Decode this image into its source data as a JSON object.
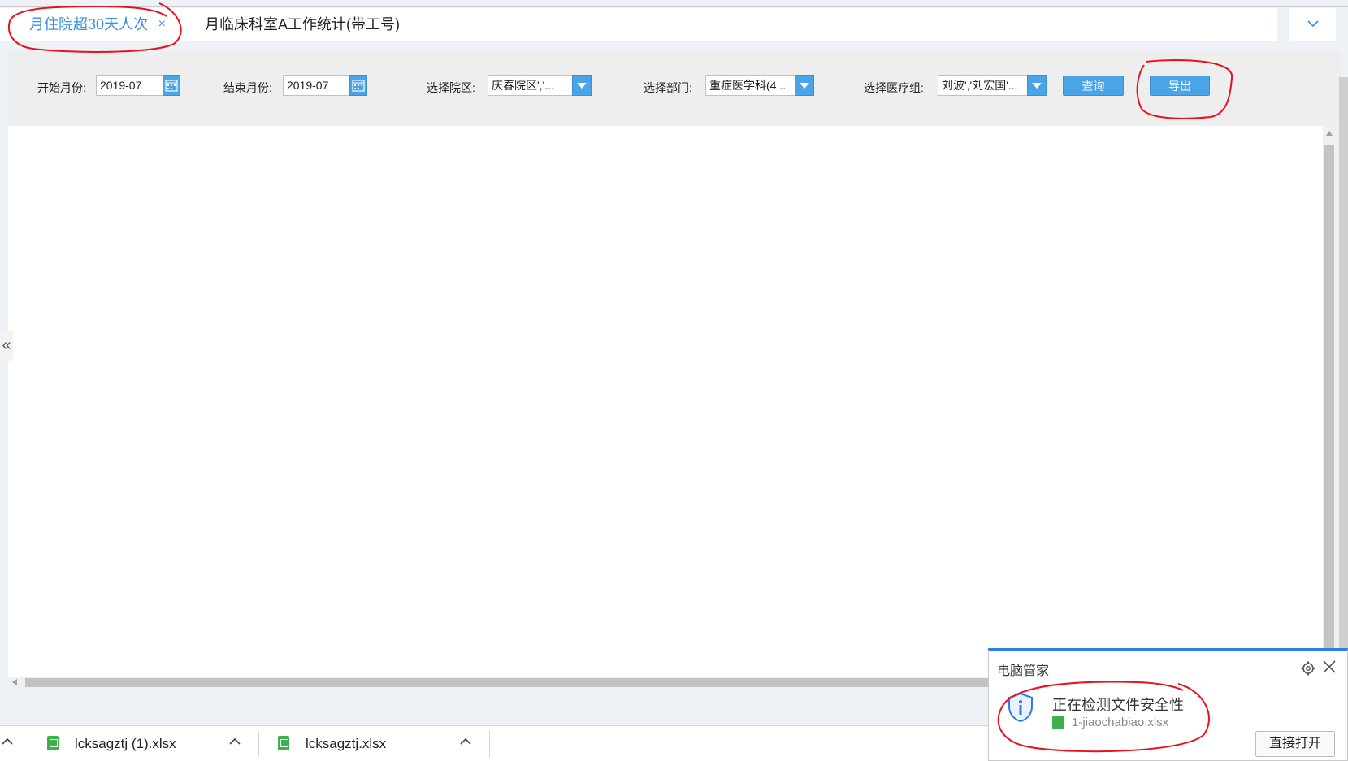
{
  "tabs": [
    {
      "label": "月住院超30天人次",
      "close": "×"
    },
    {
      "label": "月临床科室A工作统计(带工号)"
    }
  ],
  "filters": {
    "start_month_label": "开始月份:",
    "start_month_value": "2019-07",
    "end_month_label": "结束月份:",
    "end_month_value": "2019-07",
    "campus_label": "选择院区:",
    "campus_value": "庆春院区','...",
    "dept_label": "选择部门:",
    "dept_value": "重症医学科(4...",
    "team_label": "选择医疗组:",
    "team_value": "刘波','刘宏国'...",
    "query_label": "查询",
    "export_label": "导出"
  },
  "side_toggle": "«",
  "downloads": [
    {
      "name": "lcksagztj (1).xlsx"
    },
    {
      "name": "lcksagztj.xlsx"
    }
  ],
  "popup": {
    "title": "电脑管家",
    "message": "正在检测文件安全性",
    "file": "1-jiaochabiao.xlsx",
    "open_label": "直接打开"
  },
  "colors": {
    "accent": "#3a8ee6",
    "button": "#4aa4e8",
    "annotation": "#e8111b",
    "popup_border": "#2c7fe0"
  }
}
